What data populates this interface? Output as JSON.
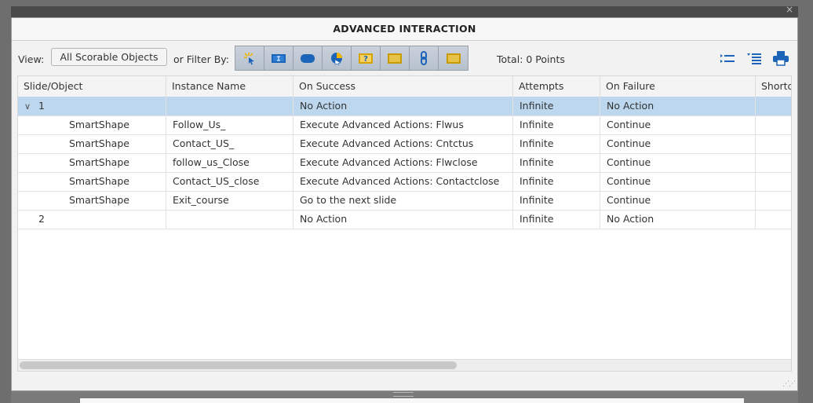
{
  "dialog": {
    "title": "ADVANCED INTERACTION",
    "close_glyph": "×"
  },
  "toolbar": {
    "view_label": "View:",
    "view_value": "All Scorable Objects",
    "filter_label": "or Filter By:",
    "filter_icons": [
      "click-box-icon",
      "text-entry-box-icon",
      "button-icon",
      "quiz-chart-icon",
      "question-slide-icon",
      "image-button-icon",
      "hyperlink-icon",
      "image-icon"
    ],
    "total": "Total: 0 Points",
    "right_icons": [
      "collapse-all-icon",
      "expand-all-icon",
      "print-icon"
    ]
  },
  "table": {
    "headers": [
      "Slide/Object",
      "Instance Name",
      "On Success",
      "Attempts",
      "On Failure",
      "Shortc"
    ],
    "rows": [
      {
        "slide": "1",
        "object": "",
        "instance": "",
        "on_success": "No Action",
        "attempts": "Infinite",
        "on_failure": "No Action",
        "shortcut": "",
        "selected": true,
        "expanded": true
      },
      {
        "slide": "",
        "object": "SmartShape",
        "instance": "Follow_Us_",
        "on_success": "Execute Advanced Actions: Flwus",
        "attempts": "Infinite",
        "on_failure": "Continue",
        "shortcut": ""
      },
      {
        "slide": "",
        "object": "SmartShape",
        "instance": "Contact_US_",
        "on_success": "Execute Advanced Actions: Cntctus",
        "attempts": "Infinite",
        "on_failure": "Continue",
        "shortcut": ""
      },
      {
        "slide": "",
        "object": "SmartShape",
        "instance": "follow_us_Close",
        "on_success": "Execute Advanced Actions: Flwclose",
        "attempts": "Infinite",
        "on_failure": "Continue",
        "shortcut": ""
      },
      {
        "slide": "",
        "object": "SmartShape",
        "instance": "Contact_US_close",
        "on_success": "Execute Advanced Actions: Contactclose",
        "attempts": "Infinite",
        "on_failure": "Continue",
        "shortcut": ""
      },
      {
        "slide": "",
        "object": "SmartShape",
        "instance": "Exit_course",
        "on_success": "Go to the next slide",
        "attempts": "Infinite",
        "on_failure": "Continue",
        "shortcut": ""
      },
      {
        "slide": "2",
        "object": "",
        "instance": "",
        "on_success": "No Action",
        "attempts": "Infinite",
        "on_failure": "No Action",
        "shortcut": ""
      }
    ]
  },
  "colors": {
    "selected_row": "#bcd7ee",
    "filter_bar": "#bfc8d4",
    "icon_blue": "#1b64b8"
  }
}
